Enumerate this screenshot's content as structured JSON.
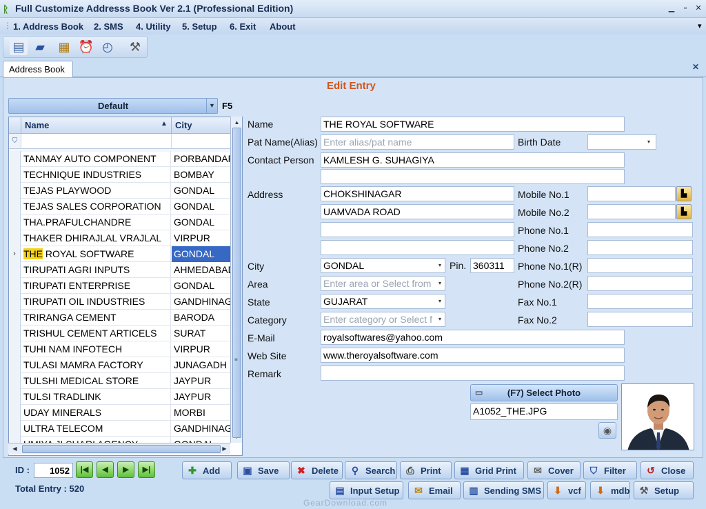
{
  "app": {
    "title": "Full Customize Addresss Book Ver 2.1 (Professional Edition)",
    "min": "▁",
    "max": "▫",
    "close": "✕"
  },
  "menu": [
    "1. Address Book",
    "2. SMS",
    "4. Utility",
    "5. Setup",
    "6. Exit",
    "About"
  ],
  "menu_overflow": "▾",
  "toolbar_icons": [
    "contacts-icon",
    "briefcase-icon",
    "notepad-icon",
    "alarm-clock-icon",
    "backup-icon",
    "tools-icon"
  ],
  "tab": {
    "label": "Address Book",
    "close": "✕"
  },
  "edit_title": "Edit Entry",
  "group_combo": {
    "value": "Default",
    "shortcut": "F5"
  },
  "grid": {
    "columns": [
      "Name",
      "City"
    ],
    "sort_indicator": "▲",
    "filter_icon": "⛉",
    "rows": [
      {
        "name": "TANMAY AUTO COMPONENT",
        "city": "PORBANDAR"
      },
      {
        "name": "TECHNIQUE INDUSTRIES",
        "city": "BOMBAY"
      },
      {
        "name": "TEJAS PLAYWOOD",
        "city": "GONDAL"
      },
      {
        "name": "TEJAS SALES CORPORATION",
        "city": "GONDAL"
      },
      {
        "name": "THA.PRAFULCHANDRE",
        "city": "GONDAL"
      },
      {
        "name": "THAKER DHIRAJLAL VRAJLAL",
        "city": "VIRPUR"
      },
      {
        "name_highlight": "THE",
        "name_rest": " ROYAL SOFTWARE",
        "city": "GONDAL",
        "marker": "›"
      },
      {
        "name": "TIRUPATI AGRI INPUTS",
        "city": "AHMEDABAD"
      },
      {
        "name": "TIRUPATI ENTERPRISE",
        "city": "GONDAL"
      },
      {
        "name": "TIRUPATI OIL INDUSTRIES",
        "city": "GANDHINAGAR"
      },
      {
        "name": "TRIRANGA CEMENT",
        "city": "BARODA"
      },
      {
        "name": "TRISHUL CEMENT ARTICELS",
        "city": "SURAT"
      },
      {
        "name": "TUHI NAM INFOTECH",
        "city": "VIRPUR"
      },
      {
        "name": "TULASI MAMRA FACTORY",
        "city": "JUNAGADH"
      },
      {
        "name": "TULSHI MEDICAL STORE",
        "city": "JAYPUR"
      },
      {
        "name": "TULSI TRADLINK",
        "city": "JAYPUR"
      },
      {
        "name": "UDAY MINERALS",
        "city": "MORBI"
      },
      {
        "name": "ULTRA TELECOM",
        "city": "GANDHINAGAR"
      },
      {
        "name": "UMIYA JI SHARI AGENCY",
        "city": "GONDAL"
      }
    ]
  },
  "form": {
    "labels": {
      "name": "Name",
      "pat_name": "Pat Name(Alias)",
      "birth_date": "Birth Date",
      "contact_person": "Contact Person",
      "address": "Address",
      "mobile1": "Mobile No.1",
      "mobile2": "Mobile No.2",
      "phone1": "Phone No.1",
      "phone2": "Phone No.2",
      "city": "City",
      "pin": "Pin.",
      "phone1r": "Phone No.1(R)",
      "area": "Area",
      "phone2r": "Phone No.2(R)",
      "state": "State",
      "fax1": "Fax No.1",
      "category": "Category",
      "fax2": "Fax No.2",
      "email": "E-Mail",
      "website": "Web Site",
      "remark": "Remark"
    },
    "values": {
      "name": "THE ROYAL SOFTWARE",
      "pat_name_placeholder": "Enter alias/pat name",
      "contact_person": "KAMLESH G. SUHAGIYA",
      "contact_person2": "",
      "address1": "CHOKSHINAGAR",
      "address2": "UAMVADA ROAD",
      "address3": "",
      "address4": "",
      "city": "GONDAL",
      "pin": "360311",
      "area_placeholder": "Enter area or Select from",
      "state": "GUJARAT",
      "category_placeholder": "Enter category or Select f",
      "email": "royalsoftwares@yahoo.com",
      "website": "www.theroyalsoftware.com",
      "remark": ""
    },
    "dropdown_arrow": "▾"
  },
  "photo": {
    "button": "(F7) Select Photo",
    "filename": "A1052_THE.JPG"
  },
  "navigation": {
    "id_label": "ID :",
    "id_value": "1052",
    "first": "|◀",
    "prev": "◀",
    "next": "▶",
    "last": "▶|",
    "total": "Total Entry : 520"
  },
  "buttons_row1": [
    {
      "label": "Add",
      "icon": "✚",
      "color": "#2c9a2c"
    },
    {
      "label": "Save",
      "icon": "▣",
      "color": "#2a4ea0"
    },
    {
      "label": "Delete",
      "icon": "✖",
      "color": "#d02020"
    },
    {
      "label": "Search",
      "icon": "⚲",
      "color": "#2a4ea0"
    },
    {
      "label": "Print",
      "icon": "⎙",
      "color": "#444"
    },
    {
      "label": "Grid Print",
      "icon": "▦",
      "color": "#2a4ea0"
    },
    {
      "label": "Cover",
      "icon": "✉",
      "color": "#666"
    },
    {
      "label": "Filter",
      "icon": "⛉",
      "color": "#2a4ea0"
    },
    {
      "label": "Close",
      "icon": "↺",
      "color": "#c01818"
    }
  ],
  "buttons_row2": [
    {
      "label": "Input Setup",
      "icon": "▤",
      "color": "#2a4ea0"
    },
    {
      "label": "Email",
      "icon": "✉",
      "color": "#c08a10"
    },
    {
      "label": "Sending SMS",
      "icon": "▥",
      "color": "#2a4ea0"
    },
    {
      "label": "vcf",
      "icon": "⬇",
      "color": "#d06a10"
    },
    {
      "label": "mdb",
      "icon": "⬇",
      "color": "#d06a10"
    },
    {
      "label": "Setup",
      "icon": "⚒",
      "color": "#555"
    }
  ],
  "watermark": "GearDownload.com",
  "colors": {
    "accent": "#d2551c",
    "selection": "#3768c4",
    "highlight": "#f6d21a"
  }
}
